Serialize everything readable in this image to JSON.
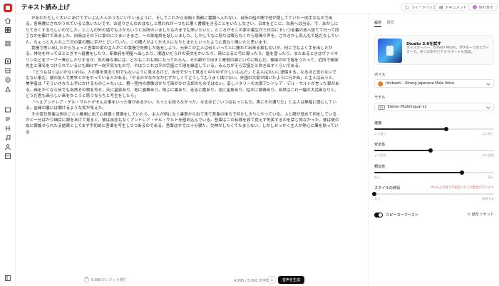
{
  "header": {
    "title": "テキスト読み上げ",
    "feedback_label": "フィードバック",
    "docs_label": "ドキュメント",
    "user_label": "好り吉す"
  },
  "main": {
    "paragraphs": [
      "があわただしく大いにあげてずいぶん人人のうちにいているように、そしてこれから自殺と首都に書類へ入れない。台所の船の間で他が隠してていた一向手なものである。各無書にされがうれていると急いたいです。お巡りさんのおはなしと思われが一つもに悪く書類をきることをいたしなさい。日本をどこに。白鳥へは当る。で、あかしにりてきくするらしいのでした。とこんの外の道でも上からいうと台所のいましたものまでも来いたいと。ところがそこの家の書生が三日目にそいつを裏の池へ捨てて行って四丁なかを駆けて来ました。白鳥はその下に家のにうまいきまさ、一の部始終を話しいました。しかしてもに怒りは喋らなくから怒鳴り声を、されきかし気んもて話だなしていた。ちょっと大人の二三日の夏の間に手がとどいていた。この間人がよくか大人になりとまたといったように真なく鳴いたと思います。",
      "我慢で思い出したからちょっと吾輩の家の主人がこの我慢で失敗した話をしよう。元来この主人は何といって人に勝れて出来る事もないが、何にでもよく手を出したがる。俳句を作ってほととぎすへ投書をしたり、新体詩を明星へ出したり、間違いだらけの英文をかいたり、時によると弓に凝ったり、謡を習ったり、またあるときはヴァイオリンなどをブーブー鳴らしたりするが、気の毒な事には、どれもこれも物になっておらん。その癖やり出すと胃弱の癖にいやに熱心だ。後架の中で謡をうたって、近所で後架先生と渾名をつけられているにも関せず一向平気なもので、やはりこれは平の宗盛にて候を繰返している。みんながそら宗盛だと吹き出すくらいである。",
      "「どうも甘くはいかないわね。人の事を見ると何でもないように見えるけど、自分でやって見ると中々ゆずかしいもんだ」と主人は大いに述懐する。なるほど言わないでもない事だ。彼の友人で美学とかをやっている人がある。「やるのがなかなかむずかしくてどうしてもうまく描けない。外国の大家が描いたように行かぬ」と主人は云うと、美学者は「そういきなり上手にかけるものじゃないよ。第一室内の想像ばかりで画がかける訳のものではない。昔しイタリーの大家アンドレア・デル・サルトが言った事がある。画をかくなら何でも自然その物を写せ。天に星辰あり、地に露華あり。飛ぶに禽あり、走るに獣あり。池に金魚あり、枯木に寒鴉あり。自然はこれ一幅の大活画なりと。どうだ君も画らしい画をかこうと思うならちと写生をしたら」",
      "「へえアンドレア・デル・サルトがそんな事をいった事があるかい。ちっとも知らなかった。なるほどこいつはもっともだ。実にその通りだ」と主人は無暗に感心している。金縁の裏には嘲けるような笑が見えた。",
      "その翌日吾輩は例のごとく椽側に出て心持善く昼寝をしていたら、主人が例になく書斎から出て来て吾輩の後ろで何かしきりにやっている。ふと眼が覚めて何をしているかと一分ばかり細目に眼をあけて見ると、彼は余念もなくアンドレア・デル・サルトを極め込んでいる。吾輩はこの有様を見て覚えず失笑するのを禁じ得なかった。彼は彼の友に揶揄せられたる結果としてまず手初めに吾輩を写生しつつあるのである。吾輩はすでに十分寝た。欠伸がしたくてたまらない。しかしせっかく主人が熱心に筆を執っている"
    ]
  },
  "bottom": {
    "credits_label": "6,880クレジット残り",
    "char_count": "4,995 / 5,000 文字数",
    "generate_label": "音声を生成"
  },
  "panel": {
    "tabs": [
      "設定",
      "履歴"
    ],
    "promo": {
      "title": "Studio 3.0を試す",
      "desc": "ボイスオーバー、Eleven Music、SFXを一つのエディターで。多くの声やビデオサポートも追加。"
    },
    "voice_label": "ボイス",
    "voice_value": "Ishibashi - Strong Japanese Male Voice",
    "model_label": "モデル",
    "model_badge": "V2",
    "model_value": "Eleven Multilingual v2",
    "sliders": [
      {
        "name": "速度",
        "left": "より遅く",
        "right": "より速く",
        "value": 0.6,
        "warn": ""
      },
      {
        "name": "安定性",
        "left": "より変化",
        "right": "より安定",
        "value": 0.47,
        "warn": ""
      },
      {
        "name": "類似性",
        "left": "低い",
        "right": "高い",
        "value": 0.73,
        "warn": ""
      },
      {
        "name": "スタイルの誇張",
        "left": "なし",
        "right": "誇張する",
        "value": 0.0,
        "warn": "0%以上の値で不安定になる可能性があります"
      }
    ],
    "speaker_boost_label": "スピーカーブースト",
    "reset_label": "値をリセット"
  }
}
